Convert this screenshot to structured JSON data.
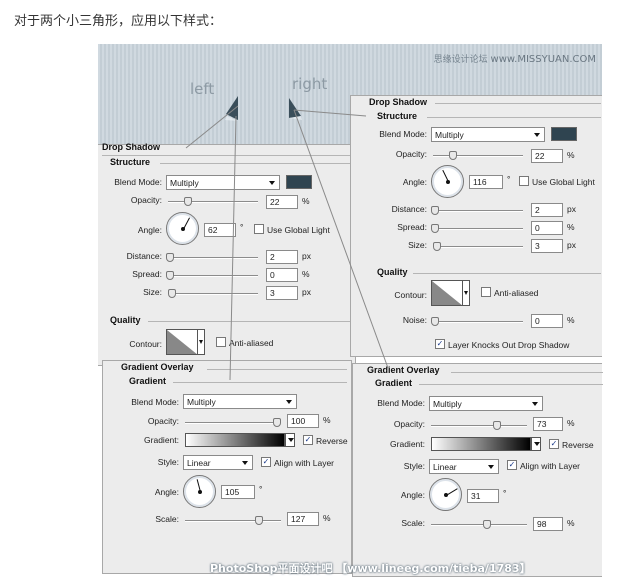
{
  "heading": "对于两个小三角形，应用以下样式：",
  "sky": {
    "label_left": "left",
    "label_right": "right",
    "watermark_cn": "思缘设计论坛",
    "watermark_url": "www.MISSYUAN.COM"
  },
  "left_panel": {
    "drop_shadow": {
      "title": "Drop Shadow",
      "structure": "Structure",
      "blend_mode_label": "Blend Mode:",
      "blend_mode_value": "Multiply",
      "shadow_color": "#2f4450",
      "opacity_label": "Opacity:",
      "opacity_value": "22",
      "opacity_unit": "%",
      "angle_label": "Angle:",
      "angle_value": "62",
      "angle_unit": "°",
      "global_light_label": "Use Global Light",
      "distance_label": "Distance:",
      "distance_value": "2",
      "distance_unit": "px",
      "spread_label": "Spread:",
      "spread_value": "0",
      "spread_unit": "%",
      "size_label": "Size:",
      "size_value": "3",
      "size_unit": "px",
      "quality": "Quality",
      "contour_label": "Contour:",
      "anti_aliased_label": "Anti-aliased"
    },
    "gradient_overlay": {
      "title": "Gradient Overlay",
      "section": "Gradient",
      "blend_mode_label": "Blend Mode:",
      "blend_mode_value": "Multiply",
      "opacity_label": "Opacity:",
      "opacity_value": "100",
      "opacity_unit": "%",
      "gradient_label": "Gradient:",
      "reverse_label": "Reverse",
      "reverse_check": "✓",
      "style_label": "Style:",
      "style_value": "Linear",
      "align_label": "Align with Layer",
      "align_check": "✓",
      "angle_label": "Angle:",
      "angle_value": "105",
      "angle_unit": "°",
      "scale_label": "Scale:",
      "scale_value": "127",
      "scale_unit": "%"
    }
  },
  "right_panel": {
    "drop_shadow": {
      "title": "Drop Shadow",
      "structure": "Structure",
      "blend_mode_label": "Blend Mode:",
      "blend_mode_value": "Multiply",
      "shadow_color": "#2f4450",
      "opacity_label": "Opacity:",
      "opacity_value": "22",
      "opacity_unit": "%",
      "angle_label": "Angle:",
      "angle_value": "116",
      "angle_unit": "°",
      "global_light_label": "Use Global Light",
      "distance_label": "Distance:",
      "distance_value": "2",
      "distance_unit": "px",
      "spread_label": "Spread:",
      "spread_value": "0",
      "spread_unit": "%",
      "size_label": "Size:",
      "size_value": "3",
      "size_unit": "px",
      "quality": "Quality",
      "contour_label": "Contour:",
      "anti_aliased_label": "Anti-aliased",
      "noise_label": "Noise:",
      "noise_value": "0",
      "noise_unit": "%",
      "knockout_label": "Layer Knocks Out Drop Shadow",
      "knockout_check": "✓"
    },
    "gradient_overlay": {
      "title": "Gradient Overlay",
      "section": "Gradient",
      "blend_mode_label": "Blend Mode:",
      "blend_mode_value": "Multiply",
      "opacity_label": "Opacity:",
      "opacity_value": "73",
      "opacity_unit": "%",
      "gradient_label": "Gradient:",
      "reverse_label": "Reverse",
      "reverse_check": "✓",
      "style_label": "Style:",
      "style_value": "Linear",
      "align_label": "Align with Layer",
      "align_check": "✓",
      "angle_label": "Angle:",
      "angle_value": "31",
      "angle_unit": "°",
      "scale_label": "Scale:",
      "scale_value": "98",
      "scale_unit": "%"
    }
  },
  "footer_watermark": "PhotoShop平面设计吧 【www.lineeg.com/tieba/1783】"
}
